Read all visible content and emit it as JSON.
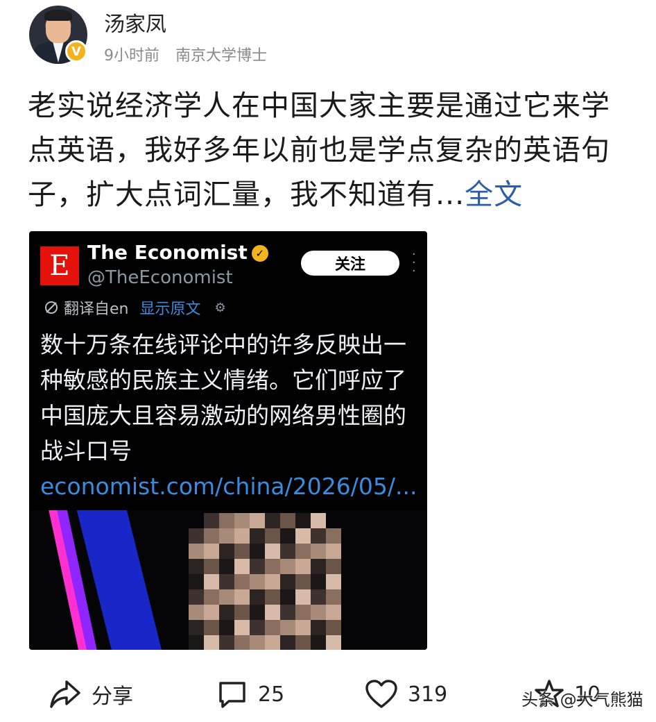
{
  "author": {
    "name": "汤家凤",
    "time": "9小时前",
    "title": "南京大学博士",
    "badge": "V"
  },
  "post": {
    "text": "老实说经济学人在中国大家主要是通过它来学点英语，我好多年以前也是学点复杂的英语句子，扩大点词汇量，我不知道有...",
    "more_label": "全文"
  },
  "tweet": {
    "logo_letter": "E",
    "account_name": "The Economist",
    "handle": "@TheEconomist",
    "follow_label": "关注",
    "translated_from": "翻译自en",
    "show_original": "显示原文",
    "text": "数十万条在线评论中的许多反映出一种敏感的民族主义情绪。它们呼应了中国庞大且容易激动的网络男性圈的战斗口号 ",
    "link": "economist.com/china/2026/05/..."
  },
  "actions": {
    "share_label": "分享",
    "comment_count": "25",
    "like_count": "319",
    "partial_count": "10"
  },
  "watermark": "头条 @大气熊猫",
  "colors": {
    "link_blue": "#2b5ea8",
    "badge_gold": "#f3b41b",
    "economist_red": "#e3120b"
  }
}
